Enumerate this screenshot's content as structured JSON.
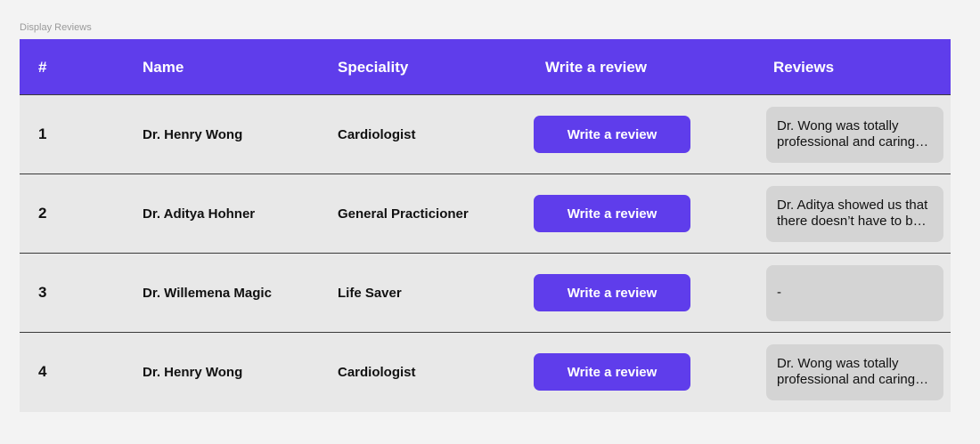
{
  "frame_label": "Display Reviews",
  "table": {
    "headers": {
      "num": "#",
      "name": "Name",
      "speciality": "Speciality",
      "write": "Write a review",
      "reviews": "Reviews"
    },
    "rows": [
      {
        "num": "1",
        "name": "Dr. Henry Wong",
        "speciality": "Cardiologist",
        "button_label": "Write a review",
        "review": "Dr. Wong was totally professional and caring with my father during his recent visit"
      },
      {
        "num": "2",
        "name": "Dr. Aditya Hohner",
        "speciality": "General Practicioner",
        "button_label": "Write a review",
        "review": "Dr. Aditya showed us that there doesn’t have to be a long wait to feel cared for"
      },
      {
        "num": "3",
        "name": "Dr. Willemena Magic",
        "speciality": "Life Saver",
        "button_label": "Write a review",
        "review": "-"
      },
      {
        "num": "4",
        "name": "Dr. Henry Wong",
        "speciality": "Cardiologist",
        "button_label": "Write a review",
        "review": "Dr. Wong was totally professional and caring with my father during his recent visit"
      }
    ]
  },
  "colors": {
    "accent": "#5f3deb",
    "row_background": "#e8e8e8",
    "review_box": "#d4d4d4",
    "page_background": "#f3f3f3"
  }
}
